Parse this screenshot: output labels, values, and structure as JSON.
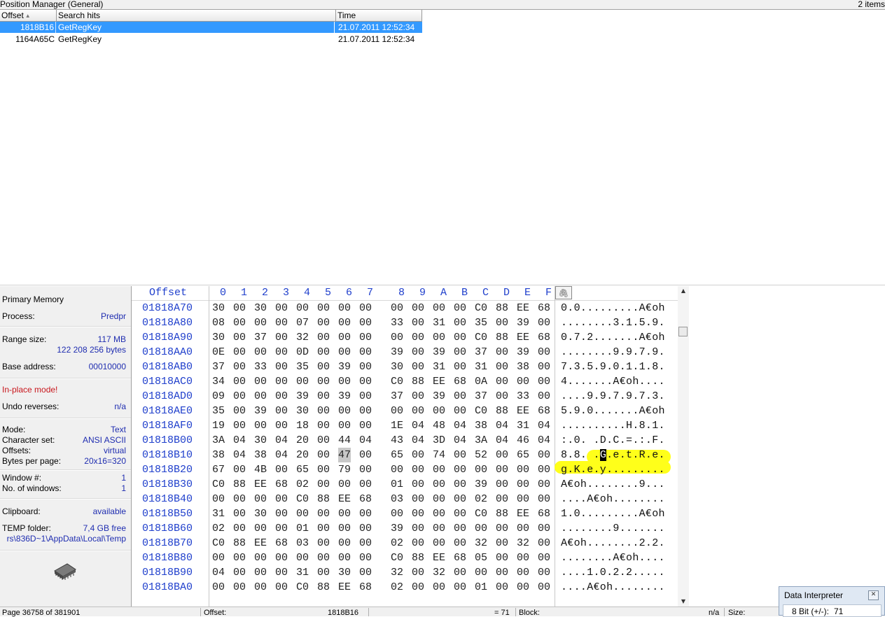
{
  "position_manager": {
    "title": "Position Manager (General)",
    "item_count": "2 items",
    "columns": [
      "Offset",
      "Search hits",
      "Time"
    ],
    "rows": [
      {
        "offset": "1818B16",
        "hit": "GetRegKey",
        "time": "21.07.2011  12:52:34",
        "selected": true
      },
      {
        "offset": "1164A65C",
        "hit": "GetRegKey",
        "time": "21.07.2011  12:52:34",
        "selected": false
      }
    ]
  },
  "info_panel": {
    "memory_type": "Primary Memory",
    "process_label": "Process:",
    "process_value": "Predpr",
    "range_size_label": "Range size:",
    "range_size_mb": "117 MB",
    "range_size_bytes": "122 208 256 bytes",
    "base_address_label": "Base address:",
    "base_address_value": "00010000",
    "inplace_mode": "In-place mode!",
    "undo_label": "Undo reverses:",
    "undo_value": "n/a",
    "mode_label": "Mode:",
    "mode_value": "Text",
    "charset_label": "Character set:",
    "charset_value": "ANSI ASCII",
    "offsets_label": "Offsets:",
    "offsets_value": "virtual",
    "bpp_label": "Bytes per page:",
    "bpp_value": "20x16=320",
    "window_label": "Window #:",
    "window_value": "1",
    "nwin_label": "No. of windows:",
    "nwin_value": "1",
    "clipboard_label": "Clipboard:",
    "clipboard_value": "available",
    "temp_label": "TEMP folder:",
    "temp_free": "7,4 GB free",
    "temp_path": "rs\\836D~1\\AppData\\Local\\Temp",
    "icon": "memory-chip-icon"
  },
  "hex_view": {
    "offset_header": "Offset",
    "col_headers": [
      "0",
      "1",
      "2",
      "3",
      "4",
      "5",
      "6",
      "7",
      "8",
      "9",
      "A",
      "B",
      "C",
      "D",
      "E",
      "F"
    ],
    "rows": [
      {
        "addr": "01818A70",
        "bytes": [
          "30",
          "00",
          "30",
          "00",
          "00",
          "00",
          "00",
          "00",
          "00",
          "00",
          "00",
          "00",
          "C0",
          "88",
          "EE",
          "68"
        ],
        "text": "0.0.........A€oh"
      },
      {
        "addr": "01818A80",
        "bytes": [
          "08",
          "00",
          "00",
          "00",
          "07",
          "00",
          "00",
          "00",
          "33",
          "00",
          "31",
          "00",
          "35",
          "00",
          "39",
          "00"
        ],
        "text": "........3.1.5.9."
      },
      {
        "addr": "01818A90",
        "bytes": [
          "30",
          "00",
          "37",
          "00",
          "32",
          "00",
          "00",
          "00",
          "00",
          "00",
          "00",
          "00",
          "C0",
          "88",
          "EE",
          "68"
        ],
        "text": "0.7.2.......A€oh"
      },
      {
        "addr": "01818AA0",
        "bytes": [
          "0E",
          "00",
          "00",
          "00",
          "0D",
          "00",
          "00",
          "00",
          "39",
          "00",
          "39",
          "00",
          "37",
          "00",
          "39",
          "00"
        ],
        "text": "........9.9.7.9."
      },
      {
        "addr": "01818AB0",
        "bytes": [
          "37",
          "00",
          "33",
          "00",
          "35",
          "00",
          "39",
          "00",
          "30",
          "00",
          "31",
          "00",
          "31",
          "00",
          "38",
          "00"
        ],
        "text": "7.3.5.9.0.1.1.8."
      },
      {
        "addr": "01818AC0",
        "bytes": [
          "34",
          "00",
          "00",
          "00",
          "00",
          "00",
          "00",
          "00",
          "C0",
          "88",
          "EE",
          "68",
          "0A",
          "00",
          "00",
          "00"
        ],
        "text": "4.......A€oh...."
      },
      {
        "addr": "01818AD0",
        "bytes": [
          "09",
          "00",
          "00",
          "00",
          "39",
          "00",
          "39",
          "00",
          "37",
          "00",
          "39",
          "00",
          "37",
          "00",
          "33",
          "00"
        ],
        "text": "....9.9.7.9.7.3."
      },
      {
        "addr": "01818AE0",
        "bytes": [
          "35",
          "00",
          "39",
          "00",
          "30",
          "00",
          "00",
          "00",
          "00",
          "00",
          "00",
          "00",
          "C0",
          "88",
          "EE",
          "68"
        ],
        "text": "5.9.0.......A€oh"
      },
      {
        "addr": "01818AF0",
        "bytes": [
          "19",
          "00",
          "00",
          "00",
          "18",
          "00",
          "00",
          "00",
          "1E",
          "04",
          "48",
          "04",
          "38",
          "04",
          "31",
          "04"
        ],
        "text": "..........H.8.1."
      },
      {
        "addr": "01818B00",
        "bytes": [
          "3A",
          "04",
          "30",
          "04",
          "20",
          "00",
          "44",
          "04",
          "43",
          "04",
          "3D",
          "04",
          "3A",
          "04",
          "46",
          "04"
        ],
        "text": ":.0. .D.C.=.:.F."
      },
      {
        "addr": "01818B10",
        "bytes": [
          "38",
          "04",
          "38",
          "04",
          "20",
          "00",
          "47",
          "00",
          "65",
          "00",
          "74",
          "00",
          "52",
          "00",
          "65",
          "00"
        ],
        "text": "8.8. .G.e.t.R.e."
      },
      {
        "addr": "01818B20",
        "bytes": [
          "67",
          "00",
          "4B",
          "00",
          "65",
          "00",
          "79",
          "00",
          "00",
          "00",
          "00",
          "00",
          "00",
          "00",
          "00",
          "00"
        ],
        "text": "g.K.e.y........."
      },
      {
        "addr": "01818B30",
        "bytes": [
          "C0",
          "88",
          "EE",
          "68",
          "02",
          "00",
          "00",
          "00",
          "01",
          "00",
          "00",
          "00",
          "39",
          "00",
          "00",
          "00"
        ],
        "text": "A€oh........9..."
      },
      {
        "addr": "01818B40",
        "bytes": [
          "00",
          "00",
          "00",
          "00",
          "C0",
          "88",
          "EE",
          "68",
          "03",
          "00",
          "00",
          "00",
          "02",
          "00",
          "00",
          "00"
        ],
        "text": "....A€oh........"
      },
      {
        "addr": "01818B50",
        "bytes": [
          "31",
          "00",
          "30",
          "00",
          "00",
          "00",
          "00",
          "00",
          "00",
          "00",
          "00",
          "00",
          "C0",
          "88",
          "EE",
          "68"
        ],
        "text": "1.0.........A€oh"
      },
      {
        "addr": "01818B60",
        "bytes": [
          "02",
          "00",
          "00",
          "00",
          "01",
          "00",
          "00",
          "00",
          "39",
          "00",
          "00",
          "00",
          "00",
          "00",
          "00",
          "00"
        ],
        "text": "........9......."
      },
      {
        "addr": "01818B70",
        "bytes": [
          "C0",
          "88",
          "EE",
          "68",
          "03",
          "00",
          "00",
          "00",
          "02",
          "00",
          "00",
          "00",
          "32",
          "00",
          "32",
          "00"
        ],
        "text": "A€oh........2.2."
      },
      {
        "addr": "01818B80",
        "bytes": [
          "00",
          "00",
          "00",
          "00",
          "00",
          "00",
          "00",
          "00",
          "C0",
          "88",
          "EE",
          "68",
          "05",
          "00",
          "00",
          "00"
        ],
        "text": "........A€oh...."
      },
      {
        "addr": "01818B90",
        "bytes": [
          "04",
          "00",
          "00",
          "00",
          "31",
          "00",
          "30",
          "00",
          "32",
          "00",
          "32",
          "00",
          "00",
          "00",
          "00",
          "00"
        ],
        "text": "....1.0.2.2....."
      },
      {
        "addr": "01818BA0",
        "bytes": [
          "00",
          "00",
          "00",
          "00",
          "C0",
          "88",
          "EE",
          "68",
          "02",
          "00",
          "00",
          "00",
          "01",
          "00",
          "00",
          "00"
        ],
        "text": "....A€oh........"
      }
    ],
    "cursor": {
      "row": 10,
      "col": 6
    },
    "highlight_color": "#ffff1a"
  },
  "status_bar": {
    "page": "Page 36758 of 381901",
    "offset_label": "Offset:",
    "offset_value": "1818B16",
    "value": "= 71",
    "block_label": "Block:",
    "block_value": "n/a",
    "size_label": "Size:"
  },
  "data_interpreter": {
    "title": "Data Interpreter",
    "label": "8 Bit (+/-):",
    "value": "71"
  }
}
